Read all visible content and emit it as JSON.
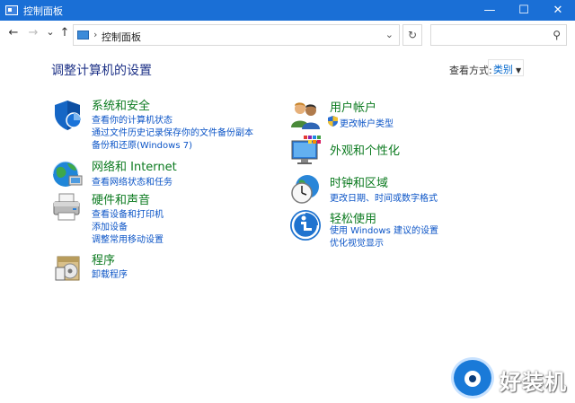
{
  "window": {
    "title": "控制面板",
    "minimize": "—",
    "maximize": "☐",
    "close": "✕"
  },
  "nav": {
    "back": "←",
    "forward": "→",
    "recent": "⌄",
    "up": "↑",
    "separator": "›",
    "breadcrumb": "控制面板",
    "dropdown": "⌄",
    "refresh": "↻",
    "search_placeholder": "",
    "search_icon": "⚲"
  },
  "header": {
    "title": "调整计算机的设置",
    "view_by_label": "查看方式:",
    "view_by_value": "类别",
    "view_by_caret": "▼"
  },
  "left_categories": [
    {
      "icon": "shield-icon",
      "title": "系统和安全",
      "links": [
        "查看你的计算机状态",
        "通过文件历史记录保存你的文件备份副本",
        "备份和还原(Windows 7)"
      ]
    },
    {
      "icon": "network-icon",
      "title": "网络和 Internet",
      "links": [
        "查看网络状态和任务"
      ]
    },
    {
      "icon": "printer-icon",
      "title": "硬件和声音",
      "links": [
        "查看设备和打印机",
        "添加设备",
        "调整常用移动设置"
      ]
    },
    {
      "icon": "programs-icon",
      "title": "程序",
      "links": [
        "卸载程序"
      ]
    }
  ],
  "right_categories": [
    {
      "icon": "users-icon",
      "title": "用户帐户",
      "links": [
        "更改帐户类型"
      ]
    },
    {
      "icon": "appearance-icon",
      "title": "外观和个性化",
      "links": []
    },
    {
      "icon": "clock-globe-icon",
      "title": "时钟和区域",
      "links": [
        "更改日期、时间或数字格式"
      ]
    },
    {
      "icon": "accessibility-icon",
      "title": "轻松使用",
      "links": [
        "使用 Windows 建议的设置",
        "优化视觉显示"
      ]
    }
  ],
  "watermark": {
    "text": "好装机"
  }
}
